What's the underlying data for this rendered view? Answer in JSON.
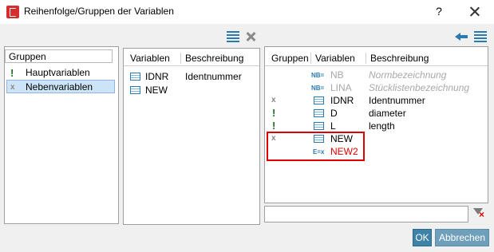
{
  "window": {
    "title": "Reihenfolge/Gruppen der Variablen",
    "help_label": "?"
  },
  "groups_panel": {
    "header": "Gruppen",
    "items": [
      {
        "label": "Hauptvariablen",
        "icon": "exclamation-icon"
      },
      {
        "label": "Nebenvariablen",
        "icon": "x-icon",
        "selected": true
      }
    ]
  },
  "middle_panel": {
    "columns": [
      "Variablen",
      "Beschreibung"
    ],
    "rows": [
      {
        "name": "IDNR",
        "description": "Identnummer"
      },
      {
        "name": "NEW",
        "description": ""
      }
    ]
  },
  "right_panel": {
    "columns": [
      "Gruppen",
      "Variablen",
      "Beschreibung"
    ],
    "rows": [
      {
        "group_icon": "",
        "type_icon": "NB=",
        "name": "NB",
        "description": "Normbezeichnung",
        "style": "disabled"
      },
      {
        "group_icon": "",
        "type_icon": "NB=",
        "name": "LINA",
        "description": "Stücklistenbezeichnung",
        "style": "disabled"
      },
      {
        "group_icon": "x",
        "type_icon": "table",
        "name": "IDNR",
        "description": "Identnummer",
        "style": "normal"
      },
      {
        "group_icon": "!",
        "type_icon": "table",
        "name": "D",
        "description": "diameter",
        "style": "normal"
      },
      {
        "group_icon": "!",
        "type_icon": "table",
        "name": "L",
        "description": "length",
        "style": "normal"
      },
      {
        "group_icon": "x",
        "type_icon": "table",
        "name": "NEW",
        "description": "",
        "style": "highlighted"
      },
      {
        "group_icon": "",
        "type_icon": "E=x",
        "name": "NEW2",
        "description": "",
        "style": "highlighted-red"
      }
    ]
  },
  "icons": {
    "nb": "NB=",
    "ex": "E=x",
    "x": "x",
    "excl": "!"
  },
  "search": {
    "value": ""
  },
  "buttons": {
    "ok": "OK",
    "cancel": "Abbrechen"
  },
  "colors": {
    "accent": "#3f82a8",
    "highlight": "#e00000",
    "icon_blue": "#2a7ab0",
    "group_green": "#1e6a1e"
  }
}
